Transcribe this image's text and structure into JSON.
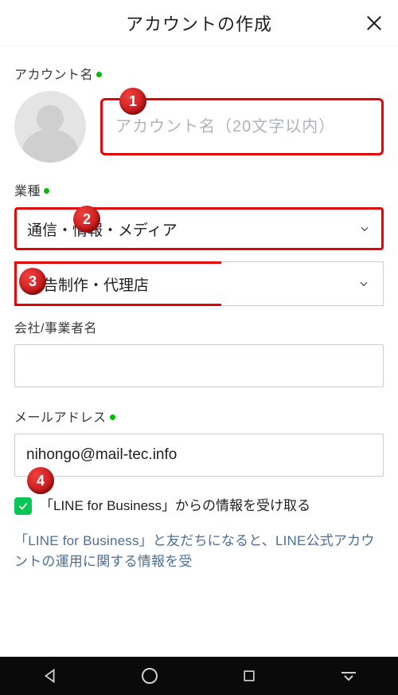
{
  "header": {
    "title": "アカウントの作成"
  },
  "fields": {
    "account_name": {
      "label": "アカウント名",
      "placeholder": "アカウント名（20文字以内）",
      "value": ""
    },
    "industry": {
      "label": "業種",
      "primary_value": "通信・情報・メディア",
      "secondary_value": "広告制作・代理店"
    },
    "company": {
      "label": "会社/事業者名",
      "value": ""
    },
    "email": {
      "label": "メールアドレス",
      "value": "nihongo@mail-tec.info"
    }
  },
  "consent": {
    "checked": true,
    "text": "「LINE for Business」からの情報を受け取る"
  },
  "info_text": "「LINE for Business」と友だちになると、LINE公式アカウントの運用に関する情報を受",
  "markers": {
    "m1": "1",
    "m2": "2",
    "m3": "3",
    "m4": "4"
  }
}
